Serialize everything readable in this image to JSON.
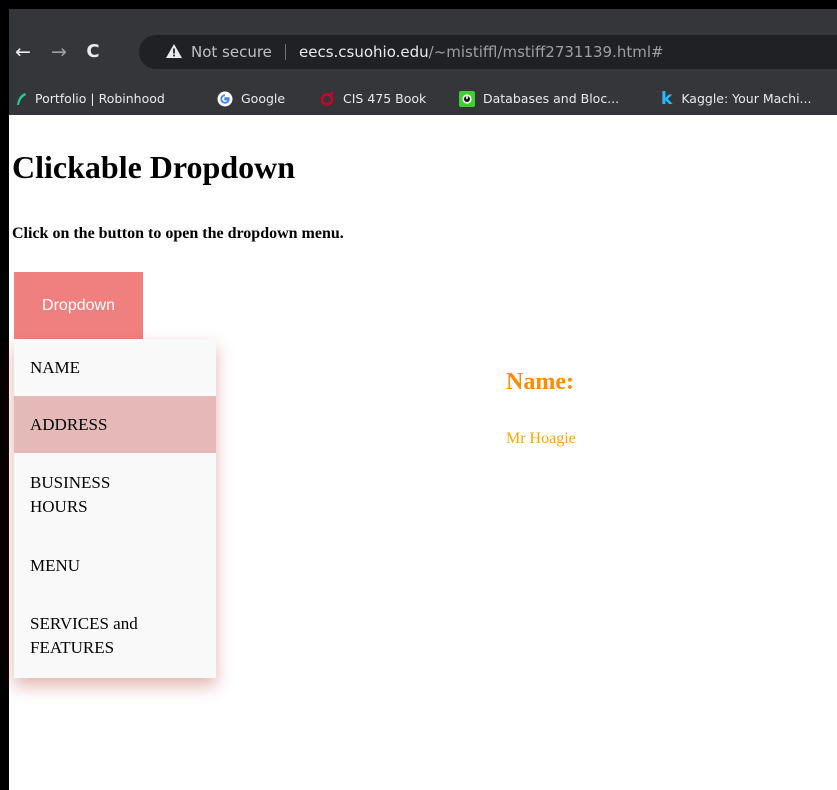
{
  "browser": {
    "back_glyph": "←",
    "forward_glyph": "→",
    "reload_glyph": "C",
    "security_text": "Not secure",
    "url_host": "eecs.csuohio.edu",
    "url_path": "/~mistiffl/mstiff2731139.html#",
    "bookmarks": [
      {
        "label": "Portfolio | Robinhood",
        "icon": "robinhood-icon",
        "color": "#21ce99"
      },
      {
        "label": "Google",
        "icon": "google-icon",
        "color": "#ffffff"
      },
      {
        "label": "CIS 475 Book",
        "icon": "oreilly-icon",
        "color": "#d3002d"
      },
      {
        "label": "Databases and Bloc...",
        "icon": "databases-icon",
        "color": "#3fcf2e"
      },
      {
        "label": "Kaggle: Your Machi...",
        "icon": "kaggle-icon",
        "color": "#20beff"
      }
    ]
  },
  "page": {
    "title": "Clickable Dropdown",
    "subtitle": "Click on the button to open the dropdown menu.",
    "dropdown_label": "Dropdown",
    "menu_items": [
      {
        "line1": "NAME",
        "line2": ""
      },
      {
        "line1": "ADDRESS",
        "line2": ""
      },
      {
        "line1": "BUSINESS",
        "line2": "HOURS"
      },
      {
        "line1": "MENU",
        "line2": ""
      },
      {
        "line1": "SERVICES and",
        "line2": "FEATURES"
      }
    ],
    "hovered_item": "ADDRESS",
    "info_heading": "Name:",
    "info_value": "Mr Hoagie"
  },
  "colors": {
    "button_bg": "#f08080",
    "menu_hover_bg": "#e6b9b9",
    "heading_color": "#ff8c00",
    "value_color": "#ffa500"
  }
}
